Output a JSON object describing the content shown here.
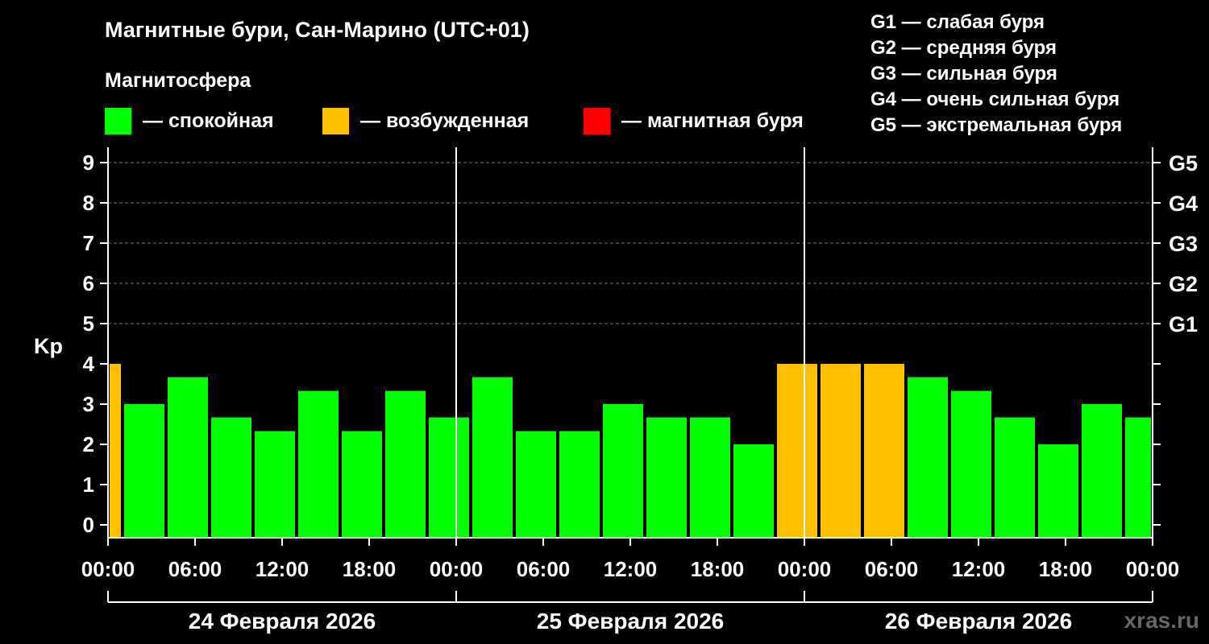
{
  "title": "Магнитные бури, Сан-Марино (UTC+01)",
  "subtitle": "Магнитосфера",
  "legend": [
    {
      "color": "#00ff00",
      "label": "— спокойная"
    },
    {
      "color": "#ffc000",
      "label": "— возбужденная"
    },
    {
      "color": "#ff0000",
      "label": "— магнитная буря"
    }
  ],
  "g_scale": [
    "G1 — слабая буря",
    "G2 — средняя буря",
    "G3 — сильная буря",
    "G4 — очень сильная буря",
    "G5 — экстремальная буря"
  ],
  "watermark": "xras.ru",
  "chart_data": {
    "type": "bar",
    "ylabel": "Kp",
    "ylim": [
      0,
      9
    ],
    "yticks": [
      "0",
      "1",
      "2",
      "3",
      "4",
      "5",
      "6",
      "7",
      "8",
      "9"
    ],
    "right_ticks": [
      {
        "y": 5,
        "label": "G1"
      },
      {
        "y": 6,
        "label": "G2"
      },
      {
        "y": 7,
        "label": "G3"
      },
      {
        "y": 8,
        "label": "G4"
      },
      {
        "y": 9,
        "label": "G5"
      }
    ],
    "grid": true,
    "x_tick_labels": [
      "00:00",
      "06:00",
      "12:00",
      "18:00",
      "00:00",
      "06:00",
      "12:00",
      "18:00",
      "00:00",
      "06:00",
      "12:00",
      "18:00",
      "00:00"
    ],
    "day_labels": [
      "24 Февраля 2026",
      "25 Февраля 2026",
      "26 Февраля 2026"
    ],
    "colors": {
      "quiet": "#00ff00",
      "active": "#ffc000",
      "storm": "#ff0000"
    },
    "bars": [
      {
        "start": "24 Февраля 2026 00:00",
        "end": "24 Февраля 2026 01:00",
        "kp": 4.0,
        "level": "active"
      },
      {
        "start": "24 Февраля 2026 01:00",
        "end": "24 Февраля 2026 04:00",
        "kp": 3.0,
        "level": "quiet"
      },
      {
        "start": "24 Февраля 2026 04:00",
        "end": "24 Февраля 2026 07:00",
        "kp": 3.67,
        "level": "quiet"
      },
      {
        "start": "24 Февраля 2026 07:00",
        "end": "24 Февраля 2026 10:00",
        "kp": 2.67,
        "level": "quiet"
      },
      {
        "start": "24 Февраля 2026 10:00",
        "end": "24 Февраля 2026 13:00",
        "kp": 2.33,
        "level": "quiet"
      },
      {
        "start": "24 Февраля 2026 13:00",
        "end": "24 Февраля 2026 16:00",
        "kp": 3.33,
        "level": "quiet"
      },
      {
        "start": "24 Февраля 2026 16:00",
        "end": "24 Февраля 2026 19:00",
        "kp": 2.33,
        "level": "quiet"
      },
      {
        "start": "24 Февраля 2026 19:00",
        "end": "24 Февраля 2026 22:00",
        "kp": 3.33,
        "level": "quiet"
      },
      {
        "start": "24 Февраля 2026 22:00",
        "end": "25 Февраля 2026 01:00",
        "kp": 2.67,
        "level": "quiet"
      },
      {
        "start": "25 Февраля 2026 01:00",
        "end": "25 Февраля 2026 04:00",
        "kp": 3.67,
        "level": "quiet"
      },
      {
        "start": "25 Февраля 2026 04:00",
        "end": "25 Февраля 2026 07:00",
        "kp": 2.33,
        "level": "quiet"
      },
      {
        "start": "25 Февраля 2026 07:00",
        "end": "25 Февраля 2026 10:00",
        "kp": 2.33,
        "level": "quiet"
      },
      {
        "start": "25 Февраля 2026 10:00",
        "end": "25 Февраля 2026 13:00",
        "kp": 3.0,
        "level": "quiet"
      },
      {
        "start": "25 Февраля 2026 13:00",
        "end": "25 Февраля 2026 16:00",
        "kp": 2.67,
        "level": "quiet"
      },
      {
        "start": "25 Февраля 2026 16:00",
        "end": "25 Февраля 2026 19:00",
        "kp": 2.67,
        "level": "quiet"
      },
      {
        "start": "25 Февраля 2026 19:00",
        "end": "25 Февраля 2026 22:00",
        "kp": 2.0,
        "level": "quiet"
      },
      {
        "start": "25 Февраля 2026 22:00",
        "end": "26 Февраля 2026 01:00",
        "kp": 4.0,
        "level": "active"
      },
      {
        "start": "26 Февраля 2026 01:00",
        "end": "26 Февраля 2026 04:00",
        "kp": 4.0,
        "level": "active"
      },
      {
        "start": "26 Февраля 2026 04:00",
        "end": "26 Февраля 2026 07:00",
        "kp": 4.0,
        "level": "active"
      },
      {
        "start": "26 Февраля 2026 07:00",
        "end": "26 Февраля 2026 10:00",
        "kp": 3.67,
        "level": "quiet"
      },
      {
        "start": "26 Февраля 2026 10:00",
        "end": "26 Февраля 2026 13:00",
        "kp": 3.33,
        "level": "quiet"
      },
      {
        "start": "26 Февраля 2026 13:00",
        "end": "26 Февраля 2026 16:00",
        "kp": 2.67,
        "level": "quiet"
      },
      {
        "start": "26 Февраля 2026 16:00",
        "end": "26 Февраля 2026 19:00",
        "kp": 2.0,
        "level": "quiet"
      },
      {
        "start": "26 Февраля 2026 19:00",
        "end": "26 Февраля 2026 22:00",
        "kp": 3.0,
        "level": "quiet"
      },
      {
        "start": "26 Февраля 2026 22:00",
        "end": "27 Февраля 2026 00:00",
        "kp": 2.67,
        "level": "quiet"
      }
    ]
  }
}
